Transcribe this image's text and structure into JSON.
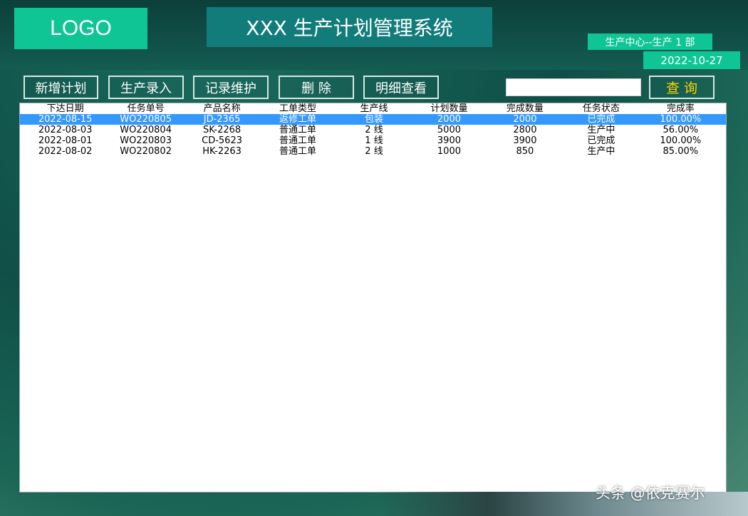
{
  "header": {
    "logo": "LOGO",
    "title": "XXX 生产计划管理系统",
    "department": "生产中心--生产 1 部",
    "date": "2022-10-27"
  },
  "toolbar": {
    "add_plan": "新增计划",
    "production_entry": "生产录入",
    "record_maintenance": "记录维护",
    "delete": "删 除",
    "detail_view": "明细查看",
    "search_value": "",
    "query": "查 询"
  },
  "table": {
    "columns": [
      "下达日期",
      "任务单号",
      "产品名称",
      "工单类型",
      "生产线",
      "计划数量",
      "完成数量",
      "任务状态",
      "完成率"
    ],
    "rows": [
      [
        "2022-08-15",
        "WO220805",
        "JD-2365",
        "返修工单",
        "包装",
        "2000",
        "2000",
        "已完成",
        "100.00%"
      ],
      [
        "2022-08-03",
        "WO220804",
        "SK-2268",
        "普通工单",
        "2 线",
        "5000",
        "2800",
        "生产中",
        "56.00%"
      ],
      [
        "2022-08-01",
        "WO220803",
        "CD-5623",
        "普通工单",
        "1 线",
        "3900",
        "3900",
        "已完成",
        "100.00%"
      ],
      [
        "2022-08-02",
        "WO220802",
        "HK-2263",
        "普通工单",
        "2 线",
        "1000",
        "850",
        "生产中",
        "85.00%"
      ]
    ],
    "selected_row": 0
  },
  "watermark": "头条 @依克赛尔",
  "colors": {
    "accent": "#0fc596",
    "title_bg": "#127c7b",
    "selection": "#3399ff",
    "query_text": "#ffd200"
  }
}
